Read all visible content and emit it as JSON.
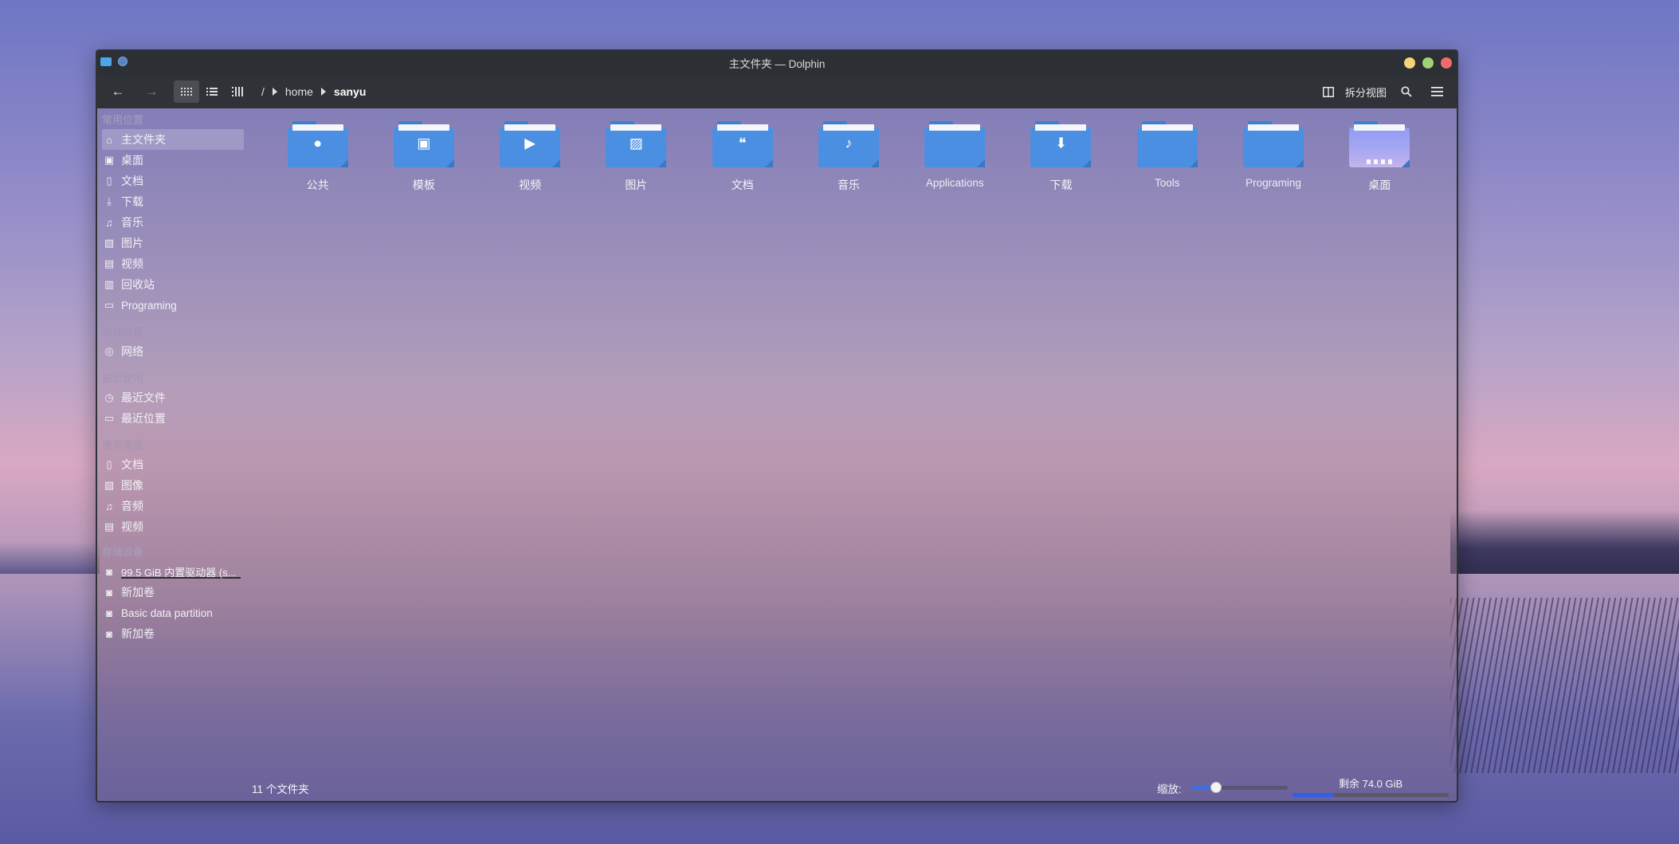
{
  "window": {
    "title": "主文件夹 — Dolphin"
  },
  "toolbar": {
    "path_root": "/",
    "path_segments": [
      "home",
      "sanyu"
    ],
    "split_view_label": "拆分视图"
  },
  "sidebar": {
    "sections": [
      {
        "title": "常用位置",
        "items": [
          {
            "label": "主文件夹",
            "icon": "home-icon",
            "selected": true
          },
          {
            "label": "桌面",
            "icon": "desktop-icon"
          },
          {
            "label": "文档",
            "icon": "document-icon"
          },
          {
            "label": "下载",
            "icon": "download-icon"
          },
          {
            "label": "音乐",
            "icon": "music-icon"
          },
          {
            "label": "图片",
            "icon": "picture-icon"
          },
          {
            "label": "视频",
            "icon": "video-icon"
          },
          {
            "label": "回收站",
            "icon": "trash-icon"
          },
          {
            "label": "Programing",
            "icon": "folder-icon"
          }
        ]
      },
      {
        "title": "远程位置",
        "items": [
          {
            "label": "网络",
            "icon": "network-icon"
          }
        ]
      },
      {
        "title": "最近使用",
        "items": [
          {
            "label": "最近文件",
            "icon": "clock-icon"
          },
          {
            "label": "最近位置",
            "icon": "folder-clock-icon"
          }
        ]
      },
      {
        "title": "搜索类型",
        "items": [
          {
            "label": "文档",
            "icon": "document-icon"
          },
          {
            "label": "图像",
            "icon": "picture-icon"
          },
          {
            "label": "音频",
            "icon": "music-icon"
          },
          {
            "label": "视频",
            "icon": "video-icon"
          }
        ]
      },
      {
        "title": "存储设备",
        "items": [
          {
            "label": "99.5 GiB 内置驱动器 (s...",
            "icon": "drive-icon"
          },
          {
            "label": "新加卷",
            "icon": "drive-icon"
          },
          {
            "label": "Basic data partition",
            "icon": "drive-icon"
          },
          {
            "label": "新加卷",
            "icon": "drive-icon"
          }
        ]
      }
    ]
  },
  "files": [
    {
      "label": "公共",
      "emblem": "user-icon"
    },
    {
      "label": "模板",
      "emblem": "template-icon"
    },
    {
      "label": "视频",
      "emblem": "play-icon"
    },
    {
      "label": "图片",
      "emblem": "image-icon"
    },
    {
      "label": "文档",
      "emblem": "quote-icon"
    },
    {
      "label": "音乐",
      "emblem": "music-note-icon"
    },
    {
      "label": "Applications",
      "emblem": ""
    },
    {
      "label": "下载",
      "emblem": "download-arrow-icon"
    },
    {
      "label": "Tools",
      "emblem": ""
    },
    {
      "label": "Programing",
      "emblem": ""
    },
    {
      "label": "桌面",
      "emblem": "desktop-wallpaper-icon"
    }
  ],
  "status": {
    "count": "11 个文件夹",
    "zoom_label": "缩放:",
    "zoom_level": 0.25,
    "free_label": "剩余 74.0 GiB",
    "used_fraction": 0.26
  }
}
